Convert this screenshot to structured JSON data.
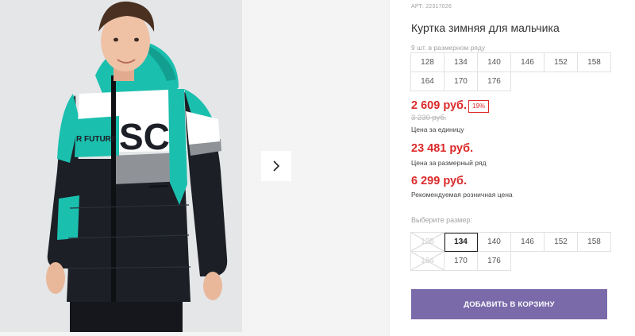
{
  "product": {
    "article": "АРТ: 22317026",
    "title": "Куртка зимняя для мальчика",
    "jacket_print": "SC",
    "jacket_stripe_text": "R FUTURE",
    "colors": {
      "accent": "#1bbfae",
      "dark": "#1c1f26",
      "price": "#dc2a2a",
      "button": "#7a6aaa"
    }
  },
  "size_row": {
    "caption": "9 шт. в размерном ряду",
    "sizes": [
      "128",
      "134",
      "140",
      "146",
      "152",
      "158",
      "164",
      "170",
      "176"
    ]
  },
  "prices": {
    "unit_price": "2 609 руб.",
    "discount": "19%",
    "old_price": "3 230 руб.",
    "unit_caption": "Цена за единицу",
    "row_price": "23 481 руб.",
    "row_caption": "Цена за размерный ряд",
    "retail_price": "6 299 руб.",
    "retail_caption": "Рекомендуемая розничная цена"
  },
  "size_select": {
    "label": "Выберите размер:",
    "sizes": [
      "128",
      "134",
      "140",
      "146",
      "152",
      "158",
      "164",
      "170",
      "176"
    ],
    "selected": "134",
    "disabled": [
      "128",
      "164"
    ]
  },
  "actions": {
    "add_to_cart": "ДОБАВИТЬ В КОРЗИНУ",
    "next_icon": "chevron-right-icon"
  }
}
